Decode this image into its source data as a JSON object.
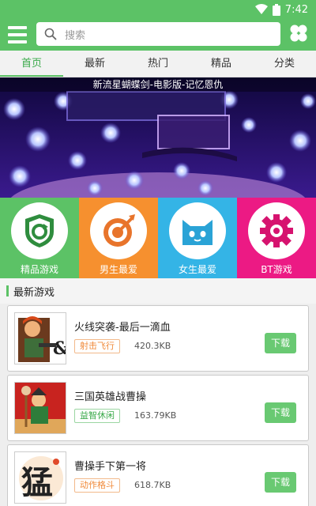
{
  "status_bar": {
    "time": "7:42"
  },
  "search": {
    "placeholder": "搜索"
  },
  "tabs": [
    {
      "label": "首页",
      "active": true
    },
    {
      "label": "最新"
    },
    {
      "label": "热门"
    },
    {
      "label": "精品"
    },
    {
      "label": "分类"
    }
  ],
  "banner": {
    "caption": "新流星蝴蝶剑-电影版-记忆恩仇"
  },
  "categories": [
    {
      "label": "精品游戏",
      "color": "#5cc266",
      "icon": "shield-refresh-icon"
    },
    {
      "label": "男生最爱",
      "color": "#f6902f",
      "icon": "target-arrow-icon"
    },
    {
      "label": "女生最爱",
      "color": "#34b4e6",
      "icon": "cat-icon"
    },
    {
      "label": "BT游戏",
      "color": "#ec1a84",
      "icon": "gear-icon"
    }
  ],
  "section": {
    "title": "最新游戏"
  },
  "games": [
    {
      "name": "火线突袭-最后一滴血",
      "tag": "射击飞行",
      "size": "420.3KB",
      "download_label": "下载"
    },
    {
      "name": "三国英雄战曹操",
      "tag": "益智休闲",
      "size": "163.79KB",
      "download_label": "下载"
    },
    {
      "name": "曹操手下第一将",
      "tag": "动作格斗",
      "size": "618.7KB",
      "download_label": "下载"
    }
  ]
}
